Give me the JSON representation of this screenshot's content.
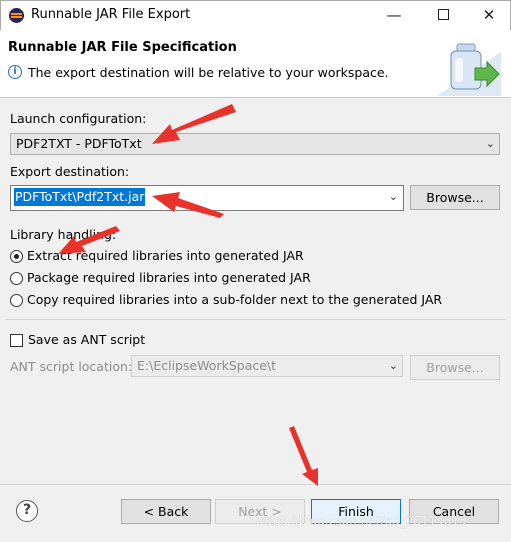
{
  "window": {
    "title": "Runnable JAR File Export",
    "min_glyph": "—",
    "close_glyph": "✕"
  },
  "header": {
    "title": "Runnable JAR File Specification",
    "info": "The export destination will be relative to your workspace.",
    "info_icon": "i"
  },
  "launch": {
    "label": "Launch configuration:",
    "value": "PDF2TXT - PDFToTxt"
  },
  "export": {
    "label": "Export destination:",
    "value": "PDFToTxt\\Pdf2Txt.jar",
    "browse": "Browse..."
  },
  "library": {
    "label": "Library handling:",
    "options": [
      "Extract required libraries into generated JAR",
      "Package required libraries into generated JAR",
      "Copy required libraries into a sub-folder next to the generated JAR"
    ],
    "selected_index": 0
  },
  "ant": {
    "checkbox_label": "Save as ANT script",
    "checked": false,
    "location_label": "ANT script location:",
    "location_value": "E:\\EclipseWorkSpace\\t",
    "browse": "Browse..."
  },
  "footer": {
    "help": "?",
    "back": "< Back",
    "next": "Next >",
    "finish": "Finish",
    "cancel": "Cancel"
  },
  "watermark": "https://blog.csdn.net/qq_28114615",
  "icons": {
    "app": "eclipse-icon",
    "info": "info-icon",
    "banner": "jar-export-icon",
    "help": "help-icon",
    "dropdown": "chevron-down-icon"
  },
  "colors": {
    "selection": "#0078d7",
    "annotation_arrow": "#e8322c"
  }
}
